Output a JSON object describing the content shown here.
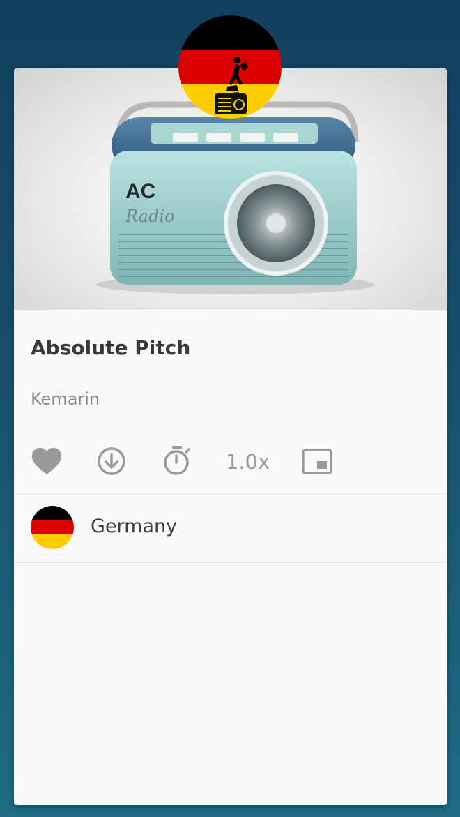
{
  "station": {
    "name": "Absolute Pitch",
    "subtitle": "Kemarin",
    "artwork_text_primary": "AC",
    "artwork_text_secondary": "Radio"
  },
  "controls": {
    "favorite_icon": "heart-icon",
    "download_icon": "download-circle-icon",
    "timer_icon": "stopwatch-icon",
    "speed_label": "1.0x",
    "pip_icon": "picture-in-picture-icon"
  },
  "country": {
    "name": "Germany",
    "flag_colors": [
      "#000000",
      "#dd0000",
      "#ffce00"
    ]
  },
  "colors": {
    "icon": "#9a9a9a",
    "background_top": "#123f5e",
    "background_bottom": "#1e6c85"
  }
}
